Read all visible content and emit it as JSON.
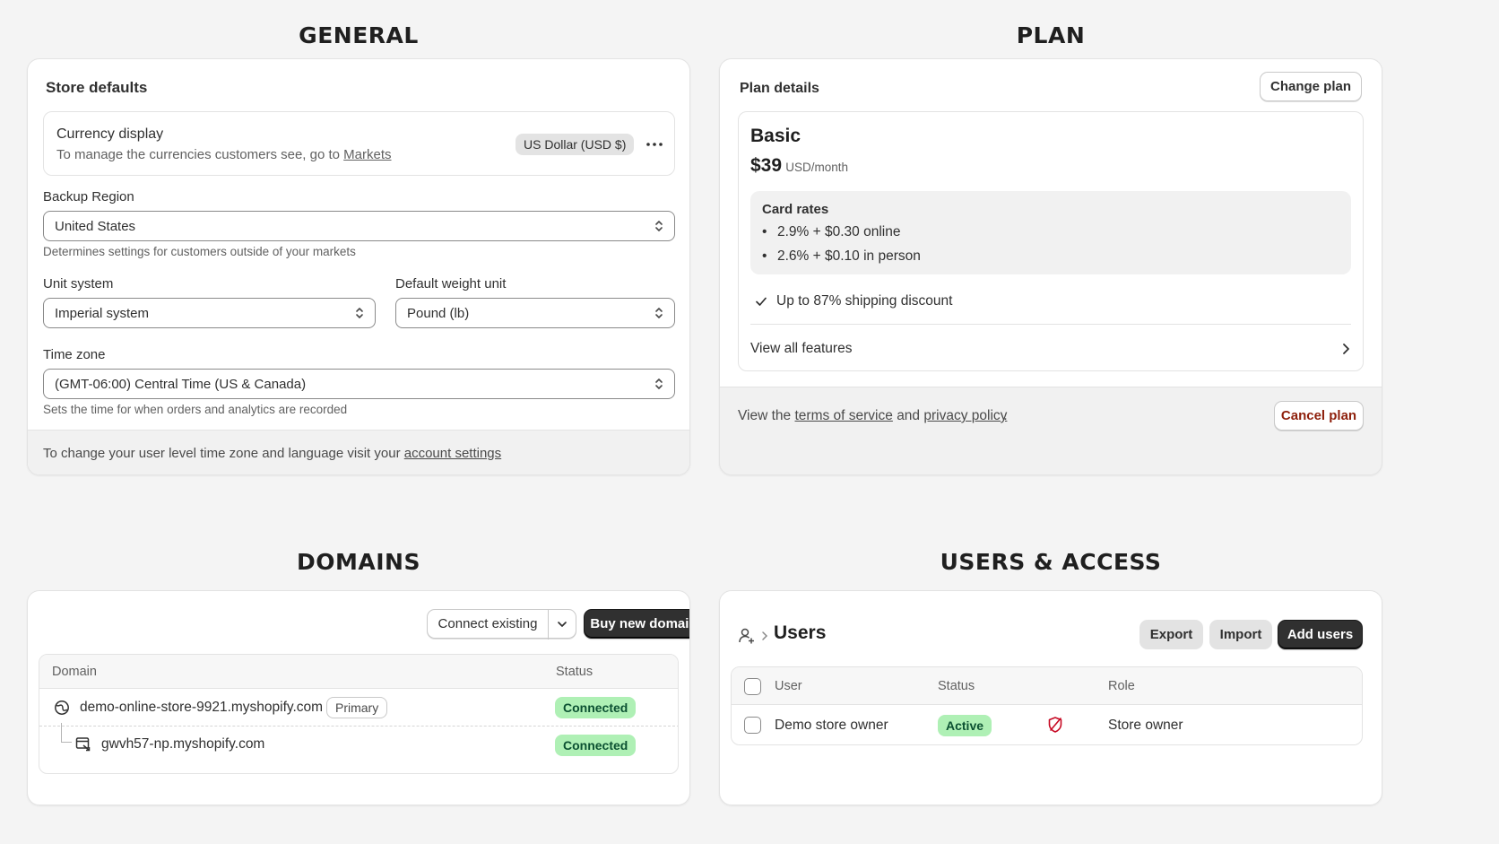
{
  "sections": {
    "general": "GENERAL",
    "plan": "PLAN",
    "domains": "DOMAINS",
    "users": "USERS & ACCESS"
  },
  "general": {
    "card_title": "Store defaults",
    "currency": {
      "title": "Currency display",
      "desc": "To manage the currencies customers see, go to",
      "link": "Markets",
      "badge": "US Dollar (USD $)",
      "more_icon": "more-horizontal-icon"
    },
    "backup_region": {
      "label": "Backup Region",
      "value": "United States",
      "help": "Determines settings for customers outside of your markets"
    },
    "unit_system": {
      "label": "Unit system",
      "value": "Imperial system"
    },
    "weight_unit": {
      "label": "Default weight unit",
      "value": "Pound (lb)"
    },
    "time_zone": {
      "label": "Time zone",
      "value": "(GMT-06:00) Central Time (US & Canada)",
      "help": "Sets the time for when orders and analytics are recorded"
    },
    "footer": {
      "text": "To change your user level time zone and language visit your",
      "link": "account settings"
    }
  },
  "plan": {
    "card_title": "Plan details",
    "change_button": "Change plan",
    "name": "Basic",
    "price": "$39",
    "period": "USD/month",
    "card_rates_title": "Card rates",
    "rates": [
      "2.9% + $0.30 online",
      "2.6% + $0.10 in person"
    ],
    "shipping": "Up to 87% shipping discount",
    "view_features": "View all features",
    "footer": {
      "prefix": "View the",
      "terms": "terms of service",
      "and": "and",
      "privacy": "privacy policy",
      "suffix": "."
    },
    "cancel_button": "Cancel plan",
    "cancel_color": "#8e1f0b"
  },
  "domains": {
    "connect_button": "Connect existing",
    "buy_button": "Buy new domain",
    "headers": {
      "domain": "Domain",
      "status": "Status"
    },
    "rows": [
      {
        "domain": "demo-online-store-9921.myshopify.com",
        "tag": "Primary",
        "status": "Connected",
        "icon": "globe-icon"
      },
      {
        "domain": "gwvh57-np.myshopify.com",
        "status": "Connected",
        "icon": "redirect-icon"
      }
    ]
  },
  "users": {
    "breadcrumb_icon": "users-icon",
    "title": "Users",
    "export_button": "Export",
    "import_button": "Import",
    "add_button": "Add users",
    "headers": {
      "user": "User",
      "status": "Status",
      "role": "Role"
    },
    "rows": [
      {
        "name": "Demo store owner",
        "status": "Active",
        "role": "Store owner",
        "security_icon": "shield-off-icon"
      }
    ]
  },
  "colors": {
    "page_bg": "#f4f4f4",
    "dark_button": "#303030",
    "success_badge": "#aff0b5",
    "critical": "#8e1f0b"
  }
}
